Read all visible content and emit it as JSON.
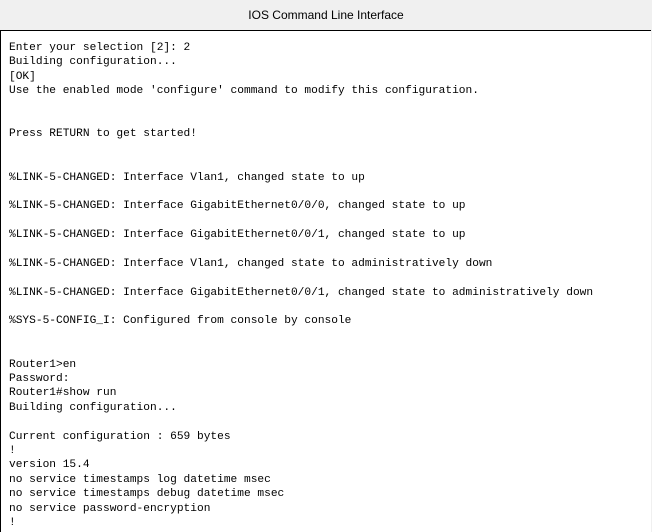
{
  "window": {
    "title": "IOS Command Line Interface"
  },
  "terminal": {
    "lines": [
      "Enter your selection [2]: 2",
      "Building configuration...",
      "[OK]",
      "Use the enabled mode 'configure' command to modify this configuration.",
      "",
      "",
      "Press RETURN to get started!",
      "",
      "",
      "%LINK-5-CHANGED: Interface Vlan1, changed state to up",
      "",
      "%LINK-5-CHANGED: Interface GigabitEthernet0/0/0, changed state to up",
      "",
      "%LINK-5-CHANGED: Interface GigabitEthernet0/0/1, changed state to up",
      "",
      "%LINK-5-CHANGED: Interface Vlan1, changed state to administratively down",
      "",
      "%LINK-5-CHANGED: Interface GigabitEthernet0/0/1, changed state to administratively down",
      "",
      "%SYS-5-CONFIG_I: Configured from console by console",
      "",
      "",
      "Router1>en",
      "Password:",
      "Router1#show run",
      "Building configuration...",
      "",
      "Current configuration : 659 bytes",
      "!",
      "version 15.4",
      "no service timestamps log datetime msec",
      "no service timestamps debug datetime msec",
      "no service password-encryption",
      "!"
    ]
  }
}
